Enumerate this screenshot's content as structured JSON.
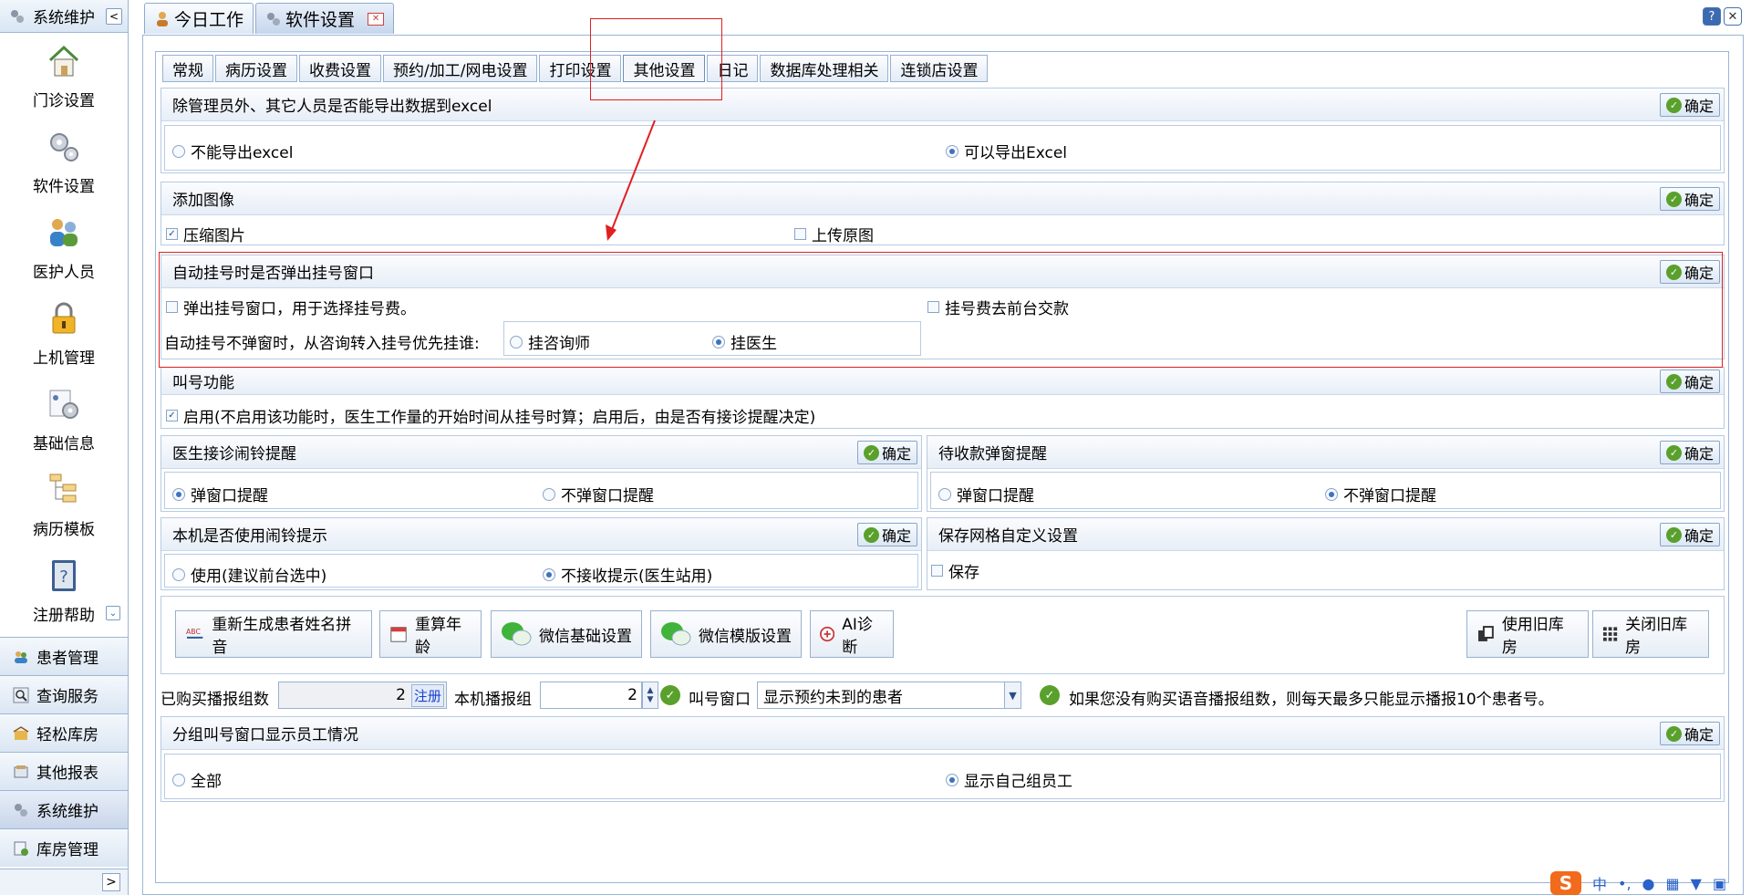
{
  "sidebar": {
    "header": "系统维护",
    "items": [
      {
        "label": "门诊设置",
        "icon": "home-icon"
      },
      {
        "label": "软件设置",
        "icon": "gears-icon"
      },
      {
        "label": "医护人员",
        "icon": "staff-icon"
      },
      {
        "label": "上机管理",
        "icon": "lock-icon"
      },
      {
        "label": "基础信息",
        "icon": "info-gear-icon"
      },
      {
        "label": "病历模板",
        "icon": "tree-icon"
      },
      {
        "label": "注册帮助",
        "icon": "help-book-icon"
      }
    ],
    "modules": [
      {
        "label": "患者管理"
      },
      {
        "label": "查询服务"
      },
      {
        "label": "轻松库房"
      },
      {
        "label": "其他报表"
      },
      {
        "label": "系统维护"
      },
      {
        "label": "库房管理"
      }
    ]
  },
  "tabs": {
    "today": "今日工作",
    "software": "软件设置"
  },
  "subtabs": [
    "常规",
    "病历设置",
    "收费设置",
    "预约/加工/网电设置",
    "打印设置",
    "其他设置",
    "日记",
    "数据库处理相关",
    "连锁店设置"
  ],
  "ok_label": "确定",
  "export": {
    "title": "除管理员外、其它人员是否能导出数据到excel",
    "opt1": "不能导出excel",
    "opt2": "可以导出Excel"
  },
  "image": {
    "title": "添加图像",
    "opt1": "压缩图片",
    "opt2": "上传原图"
  },
  "autoreg": {
    "title": "自动挂号时是否弹出挂号窗口",
    "opt1": "弹出挂号窗口，用于选择挂号费。",
    "opt2": "挂号费去前台交款",
    "priority_label": "自动挂号不弹窗时，从咨询转入挂号优先挂谁:",
    "p1": "挂咨询师",
    "p2": "挂医生"
  },
  "call": {
    "title": "叫号功能",
    "enable": "启用(不启用该功能时，医生工作量的开始时间从挂号时算；启用后，由是否有接诊提醒决定)"
  },
  "doctor_alarm": {
    "title": "医生接诊闹铃提醒",
    "opt1": "弹窗口提醒",
    "opt2": "不弹窗口提醒"
  },
  "pending_pay": {
    "title": "待收款弹窗提醒",
    "opt1": "弹窗口提醒",
    "opt2": "不弹窗口提醒"
  },
  "local_alarm": {
    "title": "本机是否使用闹铃提示",
    "opt1": "使用(建议前台选中)",
    "opt2": "不接收提示(医生站用)"
  },
  "grid_save": {
    "title": "保存网格自定义设置",
    "opt1": "保存"
  },
  "actions": {
    "regen": "重新生成患者姓名拼音",
    "recalc": "重算年龄",
    "wechat_basic": "微信基础设置",
    "wechat_tpl": "微信模版设置",
    "ai": "AI诊断",
    "use_old": "使用旧库房",
    "close_old": "关闭旧库房"
  },
  "broadcast": {
    "bought_label": "已购买播报组数",
    "bought_value": "2",
    "register_link": "注册",
    "local_label": "本机播报组",
    "local_value": "2",
    "window_label": "叫号窗口",
    "window_value": "显示预约未到的患者",
    "note": "如果您没有购买语音播报组数，则每天最多只能显示播报10个患者号。"
  },
  "group": {
    "title": "分组叫号窗口显示员工情况",
    "opt1": "全部",
    "opt2": "显示自己组员工"
  },
  "ime": {
    "logo": "S",
    "lang": "中"
  }
}
